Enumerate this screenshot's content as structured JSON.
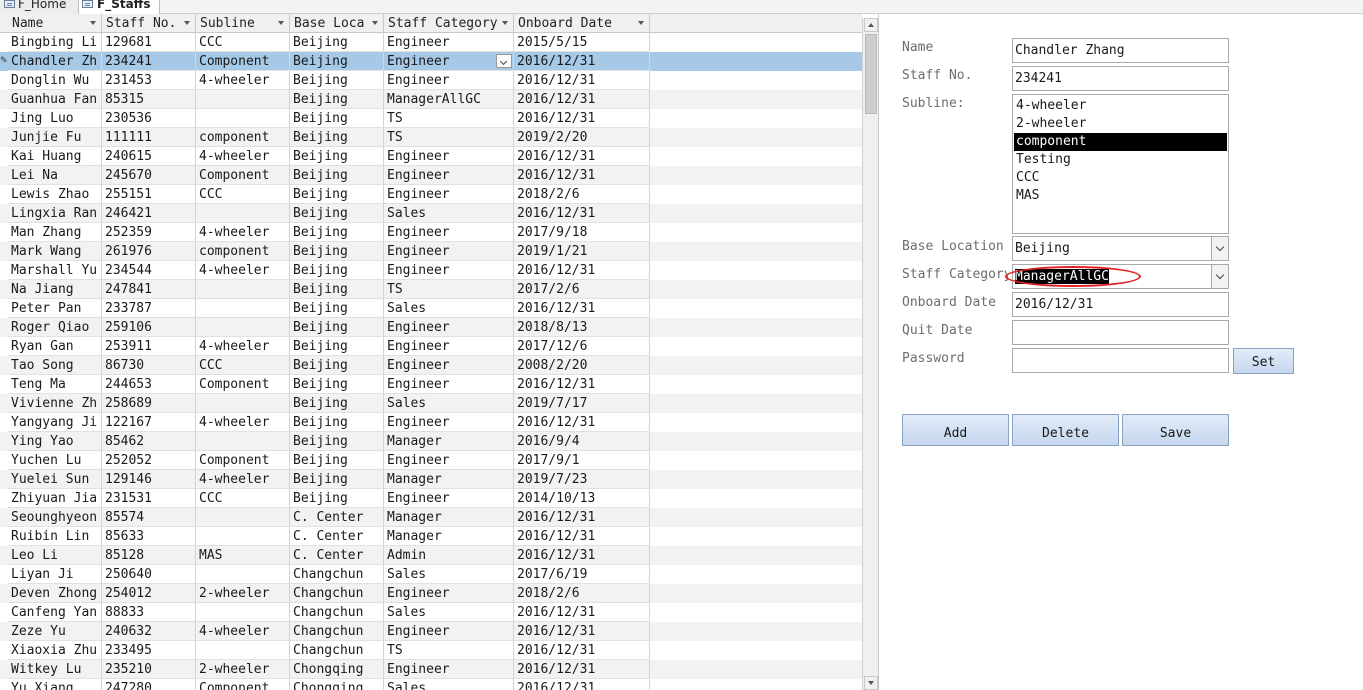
{
  "tabs": [
    {
      "label": "F_Home"
    },
    {
      "label": "F_Staffs"
    }
  ],
  "table": {
    "columns": [
      "Name",
      "Staff No.",
      "Subline",
      "Base Loca",
      "Staff Category",
      "Onboard Date"
    ],
    "rows": [
      [
        "Bingbing Li",
        "129681",
        "CCC",
        "Beijing",
        "Engineer",
        "2015/5/15"
      ],
      [
        "Chandler Zh",
        "234241",
        "Component",
        "Beijing",
        "Engineer",
        "2016/12/31"
      ],
      [
        "Donglin Wu",
        "231453",
        "4-wheeler",
        "Beijing",
        "Engineer",
        "2016/12/31"
      ],
      [
        "Guanhua Fan",
        "85315",
        "",
        "Beijing",
        "ManagerAllGC",
        "2016/12/31"
      ],
      [
        "Jing Luo",
        "230536",
        "",
        "Beijing",
        "TS",
        "2016/12/31"
      ],
      [
        "Junjie Fu",
        "111111",
        "component",
        "Beijing",
        "TS",
        "2019/2/20"
      ],
      [
        "Kai Huang",
        "240615",
        "4-wheeler",
        "Beijing",
        "Engineer",
        "2016/12/31"
      ],
      [
        "Lei Na",
        "245670",
        "Component",
        "Beijing",
        "Engineer",
        "2016/12/31"
      ],
      [
        "Lewis Zhao",
        "255151",
        "CCC",
        "Beijing",
        "Engineer",
        "2018/2/6"
      ],
      [
        "Lingxia Ran",
        "246421",
        "",
        "Beijing",
        "Sales",
        "2016/12/31"
      ],
      [
        "Man Zhang",
        "252359",
        "4-wheeler",
        "Beijing",
        "Engineer",
        "2017/9/18"
      ],
      [
        "Mark Wang",
        "261976",
        "component",
        "Beijing",
        "Engineer",
        "2019/1/21"
      ],
      [
        "Marshall Yu",
        "234544",
        "4-wheeler",
        "Beijing",
        "Engineer",
        "2016/12/31"
      ],
      [
        "Na Jiang",
        "247841",
        "",
        "Beijing",
        "TS",
        "2017/2/6"
      ],
      [
        "Peter Pan",
        "233787",
        "",
        "Beijing",
        "Sales",
        "2016/12/31"
      ],
      [
        "Roger Qiao",
        "259106",
        "",
        "Beijing",
        "Engineer",
        "2018/8/13"
      ],
      [
        "Ryan Gan",
        "253911",
        "4-wheeler",
        "Beijing",
        "Engineer",
        "2017/12/6"
      ],
      [
        "Tao Song",
        "86730",
        "CCC",
        "Beijing",
        "Engineer",
        "2008/2/20"
      ],
      [
        "Teng Ma",
        "244653",
        "Component",
        "Beijing",
        "Engineer",
        "2016/12/31"
      ],
      [
        "Vivienne Zh",
        "258689",
        "",
        "Beijing",
        "Sales",
        "2019/7/17"
      ],
      [
        "Yangyang Ji",
        "122167",
        "4-wheeler",
        "Beijing",
        "Engineer",
        "2016/12/31"
      ],
      [
        "Ying Yao",
        "85462",
        "",
        "Beijing",
        "Manager",
        "2016/9/4"
      ],
      [
        "Yuchen Lu",
        "252052",
        "Component",
        "Beijing",
        "Engineer",
        "2017/9/1"
      ],
      [
        "Yuelei Sun",
        "129146",
        "4-wheeler",
        "Beijing",
        "Manager",
        "2019/7/23"
      ],
      [
        "Zhiyuan Jia",
        "231531",
        "CCC",
        "Beijing",
        "Engineer",
        "2014/10/13"
      ],
      [
        "Seounghyeon",
        "85574",
        "",
        "C. Center",
        "Manager",
        "2016/12/31"
      ],
      [
        "Ruibin Lin",
        "85633",
        "",
        "C. Center",
        "Manager",
        "2016/12/31"
      ],
      [
        "Leo Li",
        "85128",
        "MAS",
        "C. Center",
        "Admin",
        "2016/12/31"
      ],
      [
        "Liyan Ji",
        "250640",
        "",
        "Changchun",
        "Sales",
        "2017/6/19"
      ],
      [
        "Deven Zhong",
        "254012",
        "2-wheeler",
        "Changchun",
        "Engineer",
        "2018/2/6"
      ],
      [
        "Canfeng Yan",
        "88833",
        "",
        "Changchun",
        "Sales",
        "2016/12/31"
      ],
      [
        "Zeze Yu",
        "240632",
        "4-wheeler",
        "Changchun",
        "Engineer",
        "2016/12/31"
      ],
      [
        "Xiaoxia Zhu",
        "233495",
        "",
        "Changchun",
        "TS",
        "2016/12/31"
      ],
      [
        "Witkey Lu",
        "235210",
        "2-wheeler",
        "Chongqing",
        "Engineer",
        "2016/12/31"
      ],
      [
        "Yu Xiang",
        "247280",
        "Component",
        "Chongqing",
        "Sales",
        "2016/12/31"
      ]
    ],
    "selected_row": 1
  },
  "form": {
    "name_label": "Name",
    "name_value": "Chandler Zhang",
    "staffno_label": "Staff No.",
    "staffno_value": "234241",
    "subline_label": "Subline:",
    "subline_options": [
      "4-wheeler",
      "2-wheeler",
      "component",
      "Testing",
      "CCC",
      "MAS"
    ],
    "subline_selected": 2,
    "base_label": "Base Location",
    "base_value": "Beijing",
    "category_label": "Staff Category",
    "category_value": "ManagerAllGC",
    "onboard_label": "Onboard Date",
    "onboard_value": "2016/12/31",
    "quit_label": "Quit Date",
    "quit_value": "",
    "password_label": "Password",
    "password_value": ""
  },
  "buttons": {
    "set": "Set",
    "add": "Add",
    "delete": "Delete",
    "save": "Save"
  },
  "colors": {
    "selected_row": "#a6c9e8",
    "annotation_ellipse": "#e02020",
    "button_fill": "#c5d6ee"
  }
}
